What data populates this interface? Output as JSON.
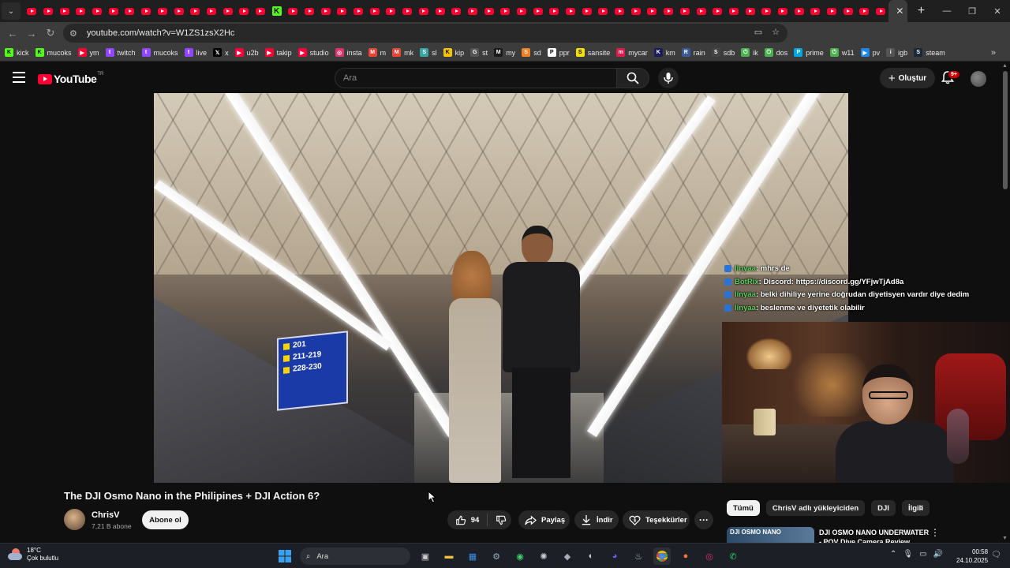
{
  "browser": {
    "tab_count": 53,
    "url": "youtube.com/watch?v=W1ZS1zsX2Hc",
    "new_tab_symbol": "+",
    "close_symbol": "✕",
    "window_controls": [
      "—",
      "❐",
      "✕"
    ]
  },
  "bookmarks": [
    {
      "label": "kick",
      "color": "#53fc18",
      "icon": "K"
    },
    {
      "label": "mucoks",
      "color": "#53fc18",
      "icon": "K"
    },
    {
      "label": "ym",
      "color": "#ff0033",
      "icon": "▶"
    },
    {
      "label": "twitch",
      "color": "#9146ff",
      "icon": "t"
    },
    {
      "label": "mucoks",
      "color": "#9146ff",
      "icon": "t"
    },
    {
      "label": "live",
      "color": "#9146ff",
      "icon": "t"
    },
    {
      "label": "x",
      "color": "#000000",
      "icon": "𝕏"
    },
    {
      "label": "u2b",
      "color": "#ff0033",
      "icon": "▶"
    },
    {
      "label": "takip",
      "color": "#ff0033",
      "icon": "▶"
    },
    {
      "label": "studio",
      "color": "#ff0033",
      "icon": "▶"
    },
    {
      "label": "insta",
      "color": "#e1306c",
      "icon": "◎"
    },
    {
      "label": "m",
      "color": "#ea4335",
      "icon": "M"
    },
    {
      "label": "mk",
      "color": "#ea4335",
      "icon": "M"
    },
    {
      "label": "sl",
      "color": "#3ca4a4",
      "icon": "S"
    },
    {
      "label": "kip",
      "color": "#f5c400",
      "icon": "K"
    },
    {
      "label": "st",
      "color": "#555555",
      "icon": "G"
    },
    {
      "label": "my",
      "color": "#1a1a1a",
      "icon": "M"
    },
    {
      "label": "sd",
      "color": "#f48024",
      "icon": "S"
    },
    {
      "label": "ppr",
      "color": "#ffffff",
      "icon": "P"
    },
    {
      "label": "sansite",
      "color": "#f5e000",
      "icon": "S"
    },
    {
      "label": "mycar",
      "color": "#e21b4d",
      "icon": "m"
    },
    {
      "label": "km",
      "color": "#1c1c5a",
      "icon": "K"
    },
    {
      "label": "rain",
      "color": "#3b5998",
      "icon": "R"
    },
    {
      "label": "sdb",
      "color": "#444444",
      "icon": "S"
    },
    {
      "label": "ik",
      "color": "#4caf50",
      "icon": "⏻"
    },
    {
      "label": "dos",
      "color": "#4caf50",
      "icon": "⏻"
    },
    {
      "label": "prime",
      "color": "#00a8e1",
      "icon": "P"
    },
    {
      "label": "w11",
      "color": "#4caf50",
      "icon": "⏻"
    },
    {
      "label": "pv",
      "color": "#1e88e5",
      "icon": "▶"
    },
    {
      "label": "igb",
      "color": "#555555",
      "icon": "i"
    },
    {
      "label": "steam",
      "color": "#1b2838",
      "icon": "S"
    }
  ],
  "youtube": {
    "logo_text": "YouTube",
    "region": "TR",
    "search_placeholder": "Ara",
    "create_label": "Oluştur",
    "notification_badge": "9+"
  },
  "video": {
    "title": "The DJI Osmo Nano in the Philipines + DJI Action 6?",
    "channel": "ChrisV",
    "subscribers": "7,21 B abone",
    "subscribe_label": "Abone ol",
    "likes": "94",
    "share_label": "Paylaş",
    "download_label": "İndir",
    "thanks_label": "Teşekkürler",
    "more_label": "···",
    "signs": [
      "201",
      "211-219",
      "228-230"
    ]
  },
  "chat": [
    {
      "user": "linyaa",
      "text": ": mhrs de",
      "user_color": "#5bd15b"
    },
    {
      "user": "BotRix",
      "text": ": Discord: https://discord.gg/YFjwTjAd8a",
      "user_color": "#5bd15b"
    },
    {
      "user": "linyaa",
      "text": ": belki dihiliye yerine doğrudan diyetisyen vardır diye dedim",
      "user_color": "#5bd15b"
    },
    {
      "user": "linyaa",
      "text": ": beslenme ve diyetetik olabilir",
      "user_color": "#5bd15b"
    }
  ],
  "sidebar": {
    "chips": [
      "Tümü",
      "ChrisV adlı yükleyiciden",
      "DJI",
      "İlgili"
    ],
    "recommendation_thumb_text": "DJI OSMO NANO",
    "recommendation_title": "DJI OSMO NANO UNDERWATER - POV Dive Camera Review"
  },
  "taskbar": {
    "temperature": "18°C",
    "weather": "Çok bulutlu",
    "search_placeholder": "Ara",
    "time": "00:58",
    "date": "24.10.2025"
  },
  "colors": {
    "youtube_red": "#ff0033",
    "page_bg": "#0f0f0f",
    "pill_bg": "#272727"
  }
}
